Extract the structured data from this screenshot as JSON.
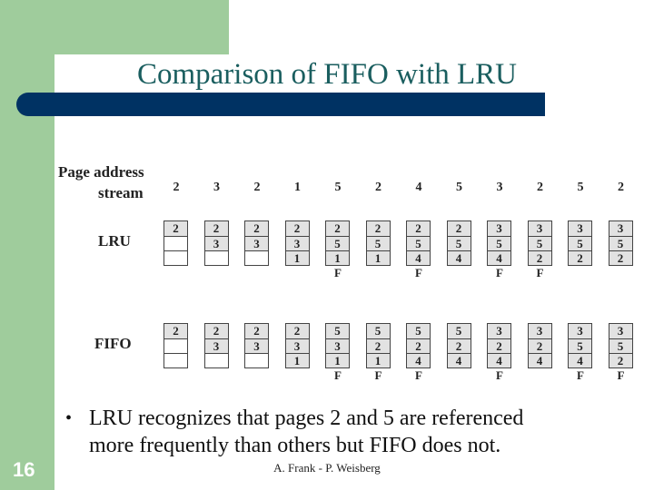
{
  "title": "Comparison of FIFO with LRU",
  "figure": {
    "stream_label_line1": "Page address",
    "stream_label_line2": "stream",
    "stream": [
      "2",
      "3",
      "2",
      "1",
      "5",
      "2",
      "4",
      "5",
      "3",
      "2",
      "5",
      "2"
    ],
    "fault_marker": "F",
    "lru": {
      "label": "LRU",
      "frames": [
        [
          "2",
          "",
          ""
        ],
        [
          "2",
          "3",
          ""
        ],
        [
          "2",
          "3",
          ""
        ],
        [
          "2",
          "3",
          "1"
        ],
        [
          "2",
          "5",
          "1"
        ],
        [
          "2",
          "5",
          "1"
        ],
        [
          "2",
          "5",
          "4"
        ],
        [
          "2",
          "5",
          "4"
        ],
        [
          "3",
          "5",
          "4"
        ],
        [
          "3",
          "5",
          "2"
        ],
        [
          "3",
          "5",
          "2"
        ],
        [
          "3",
          "5",
          "2"
        ]
      ],
      "faults": [
        false,
        false,
        false,
        false,
        true,
        false,
        true,
        false,
        true,
        true,
        false,
        false
      ]
    },
    "fifo": {
      "label": "FIFO",
      "frames": [
        [
          "2",
          "",
          ""
        ],
        [
          "2",
          "3",
          ""
        ],
        [
          "2",
          "3",
          ""
        ],
        [
          "2",
          "3",
          "1"
        ],
        [
          "5",
          "3",
          "1"
        ],
        [
          "5",
          "2",
          "1"
        ],
        [
          "5",
          "2",
          "4"
        ],
        [
          "5",
          "2",
          "4"
        ],
        [
          "3",
          "2",
          "4"
        ],
        [
          "3",
          "2",
          "4"
        ],
        [
          "3",
          "5",
          "4"
        ],
        [
          "3",
          "5",
          "2"
        ]
      ],
      "faults": [
        false,
        false,
        false,
        false,
        true,
        true,
        true,
        false,
        true,
        false,
        true,
        true
      ]
    }
  },
  "bullet": {
    "symbol": "•",
    "line1": "LRU recognizes that pages 2 and 5 are referenced",
    "line2": "more frequently than others but FIFO does not."
  },
  "footer": "A. Frank - P. Weisberg",
  "slide_number": "16",
  "colors": {
    "green": "#9fcc9c",
    "navy": "#003263",
    "title_teal": "#1a5e5f",
    "cell_fill": "#e2e2e2"
  }
}
